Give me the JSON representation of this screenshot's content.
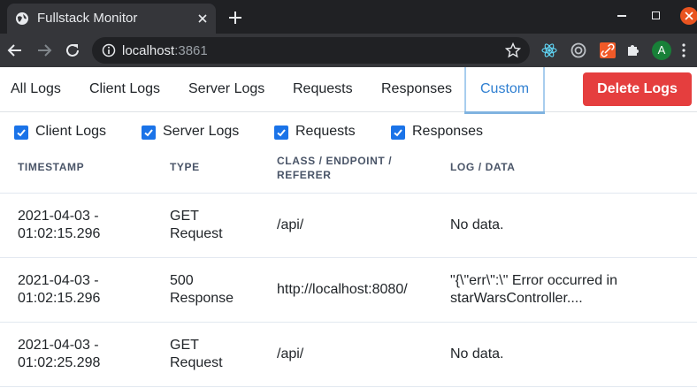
{
  "browser": {
    "tab_title": "Fullstack Monitor",
    "url_host": "localhost",
    "url_port": ":3861",
    "avatar_letter": "A",
    "icons": [
      "globe-icon",
      "close-icon",
      "plus-icon",
      "back-arrow-icon",
      "forward-arrow-icon",
      "reload-icon",
      "info-icon",
      "star-icon",
      "react-devtools-icon",
      "target-icon",
      "link-extension-icon",
      "puzzle-icon",
      "more-vert-icon"
    ]
  },
  "nav": {
    "tabs": [
      "All Logs",
      "Client Logs",
      "Server Logs",
      "Requests",
      "Responses",
      "Custom"
    ],
    "active_tab": "Custom",
    "delete_label": "Delete Logs",
    "delete_color": "#e53e3e",
    "active_color": "#2f7fd1"
  },
  "filters": [
    {
      "label": "Client Logs",
      "checked": true
    },
    {
      "label": "Server Logs",
      "checked": true
    },
    {
      "label": "Requests",
      "checked": true
    },
    {
      "label": "Responses",
      "checked": true
    }
  ],
  "table": {
    "headers": [
      "TIMESTAMP",
      "TYPE",
      "CLASS / ENDPOINT / REFERER",
      "LOG / DATA"
    ],
    "rows": [
      {
        "timestamp": "2021-04-03 - 01:02:15.296",
        "type": "GET Request",
        "endpoint": "/api/",
        "data": "No data."
      },
      {
        "timestamp": "2021-04-03 - 01:02:15.296",
        "type": "500 Response",
        "endpoint": "http://localhost:8080/",
        "data": "\"{\\\"err\\\":\\\" Error occurred in starWarsController...."
      },
      {
        "timestamp": "2021-04-03 - 01:02:25.298",
        "type": "GET Request",
        "endpoint": "/api/",
        "data": "No data."
      }
    ]
  }
}
